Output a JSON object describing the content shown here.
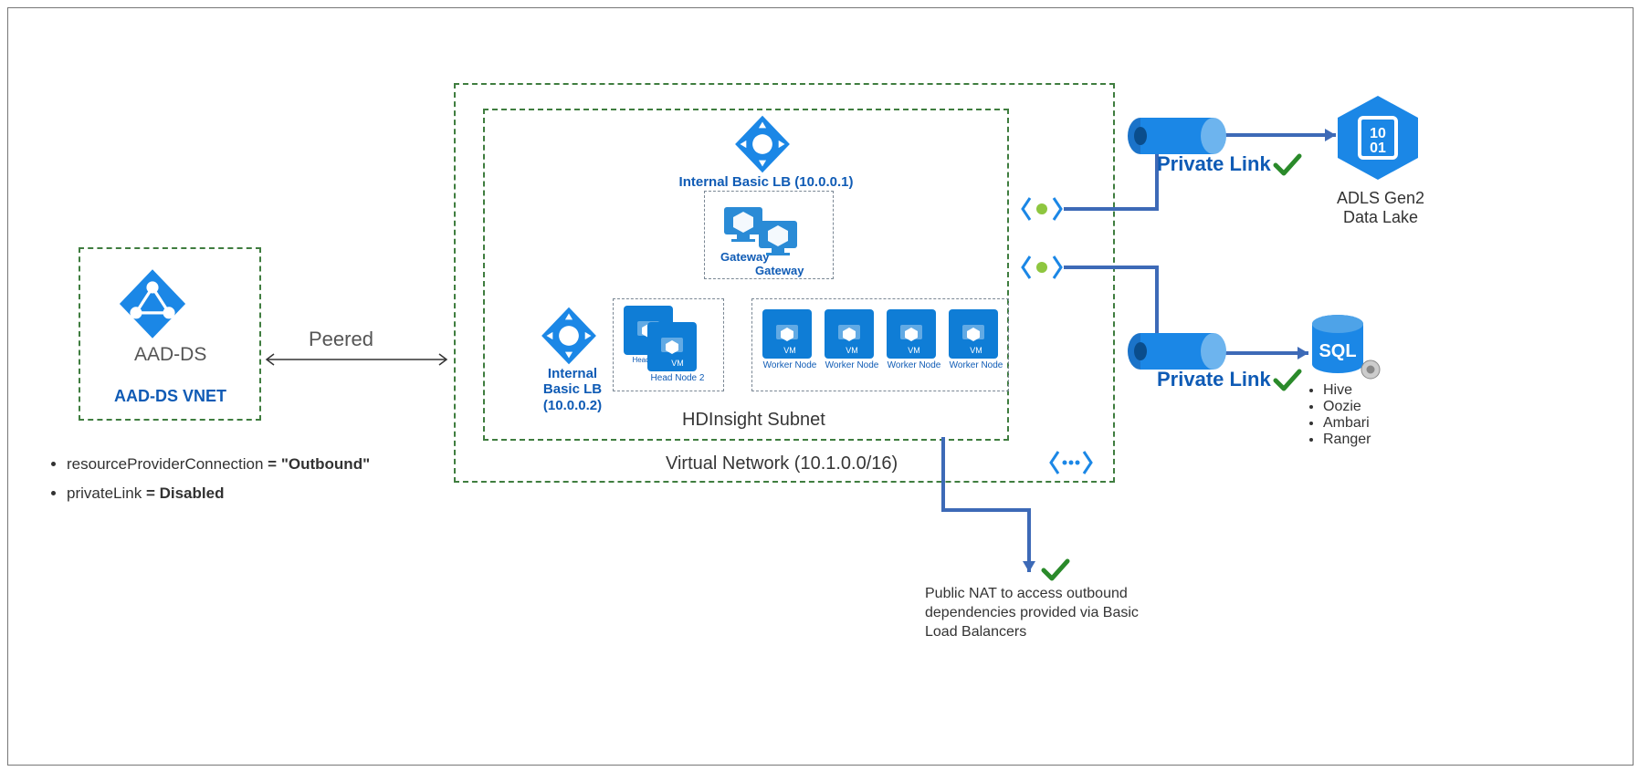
{
  "aad": {
    "title": "AAD-DS",
    "vnet": "AAD-DS VNET"
  },
  "peered": "Peered",
  "vnet": {
    "title": "Virtual Network (10.1.0.0/16)",
    "subnet": "HDInsight Subnet",
    "lb1": "Internal Basic LB (10.0.0.1)",
    "lb2_line1": "Internal",
    "lb2_line2": "Basic LB",
    "lb2_line3": "(10.0.0.2)",
    "gateway1": "Gateway",
    "gateway2": "Gateway",
    "head1": "Head N…",
    "head2": "Head Node 2",
    "workers": [
      "Worker Node",
      "Worker Node",
      "Worker Node",
      "Worker Node"
    ],
    "vm_cap": "VM"
  },
  "privateLink1": "Private Link",
  "privateLink2": "Private Link",
  "adls": {
    "line1": "ADLS Gen2",
    "line2": "Data Lake"
  },
  "sql": {
    "title": "SQL",
    "items": [
      "Hive",
      "Oozie",
      "Ambari",
      "Ranger"
    ]
  },
  "nat": "Public NAT to access outbound dependencies provided via Basic Load Balancers",
  "notes": {
    "rpc_key": "resourceProviderConnection",
    "rpc_val": " = \"Outbound\"",
    "pl_key": "privateLink",
    "pl_val": " = Disabled"
  }
}
